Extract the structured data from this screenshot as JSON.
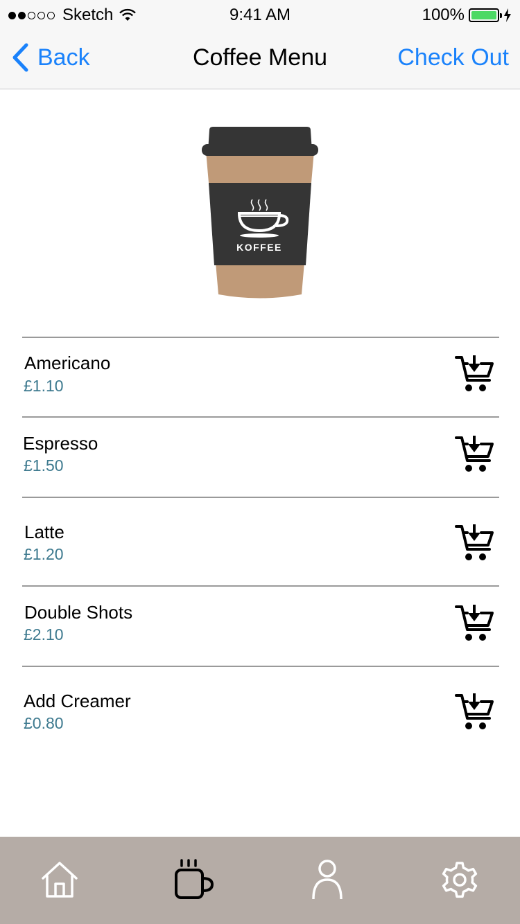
{
  "status_bar": {
    "carrier": "Sketch",
    "time": "9:41 AM",
    "battery": "100%",
    "battery_level": 1.0,
    "signal_bars_filled": 2,
    "signal_bars_total": 5
  },
  "nav": {
    "back_label": "Back",
    "title": "Coffee Menu",
    "checkout_label": "Check Out"
  },
  "hero": {
    "logo_text": "KOFFEE",
    "icon": "coffee-cup-illustration"
  },
  "menu": {
    "items": [
      {
        "name": "Americano",
        "price": "£1.10",
        "icon": "add-to-cart-icon"
      },
      {
        "name": "Espresso",
        "price": "£1.50",
        "icon": "add-to-cart-icon"
      },
      {
        "name": "Latte",
        "price": "£1.20",
        "icon": "add-to-cart-icon"
      },
      {
        "name": "Double Shots",
        "price": "£2.10",
        "icon": "add-to-cart-icon"
      },
      {
        "name": "Add Creamer",
        "price": "£0.80",
        "icon": "add-to-cart-icon"
      }
    ]
  },
  "tab_bar": {
    "tabs": [
      {
        "icon": "home-icon",
        "active": false
      },
      {
        "icon": "coffee-mug-icon",
        "active": true
      },
      {
        "icon": "profile-icon",
        "active": false
      },
      {
        "icon": "settings-gear-icon",
        "active": false
      }
    ]
  },
  "colors": {
    "accent": "#1a82fb",
    "price": "#3e7a8f",
    "tab_bar_bg": "#b5aca6",
    "cup_brown": "#c09a78",
    "cup_dark": "#353535",
    "battery": "#4cd964"
  }
}
